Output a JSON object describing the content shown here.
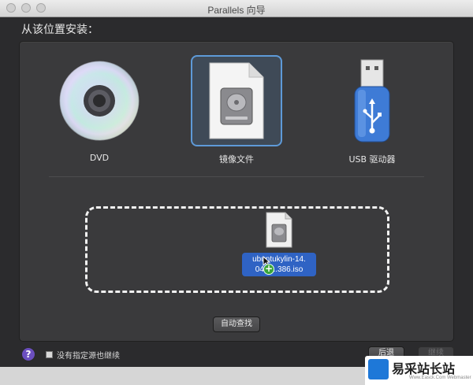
{
  "window": {
    "title": "Parallels 向导"
  },
  "heading": "从该位置安装：",
  "options": [
    {
      "label": "DVD",
      "icon": "dvd-disc-icon"
    },
    {
      "label": "镜像文件",
      "icon": "disk-image-file-icon",
      "selected": true
    },
    {
      "label": "USB 驱动器",
      "icon": "usb-drive-icon"
    }
  ],
  "dropzone": {
    "file_name": "ubuntukylin-14.\n04-d...386.iso"
  },
  "auto_find_label": "自动查找",
  "help_label": "?",
  "checkbox_label": "没有指定源也继续",
  "back_label": "后退",
  "continue_label": "继续",
  "watermark": {
    "text": "易采站长站",
    "sub": "Www.Easck.Com  Webmaster"
  },
  "colors": {
    "accent": "#5e9ad8",
    "file_highlight": "#2f63c4",
    "background": "#2b2b2d"
  }
}
